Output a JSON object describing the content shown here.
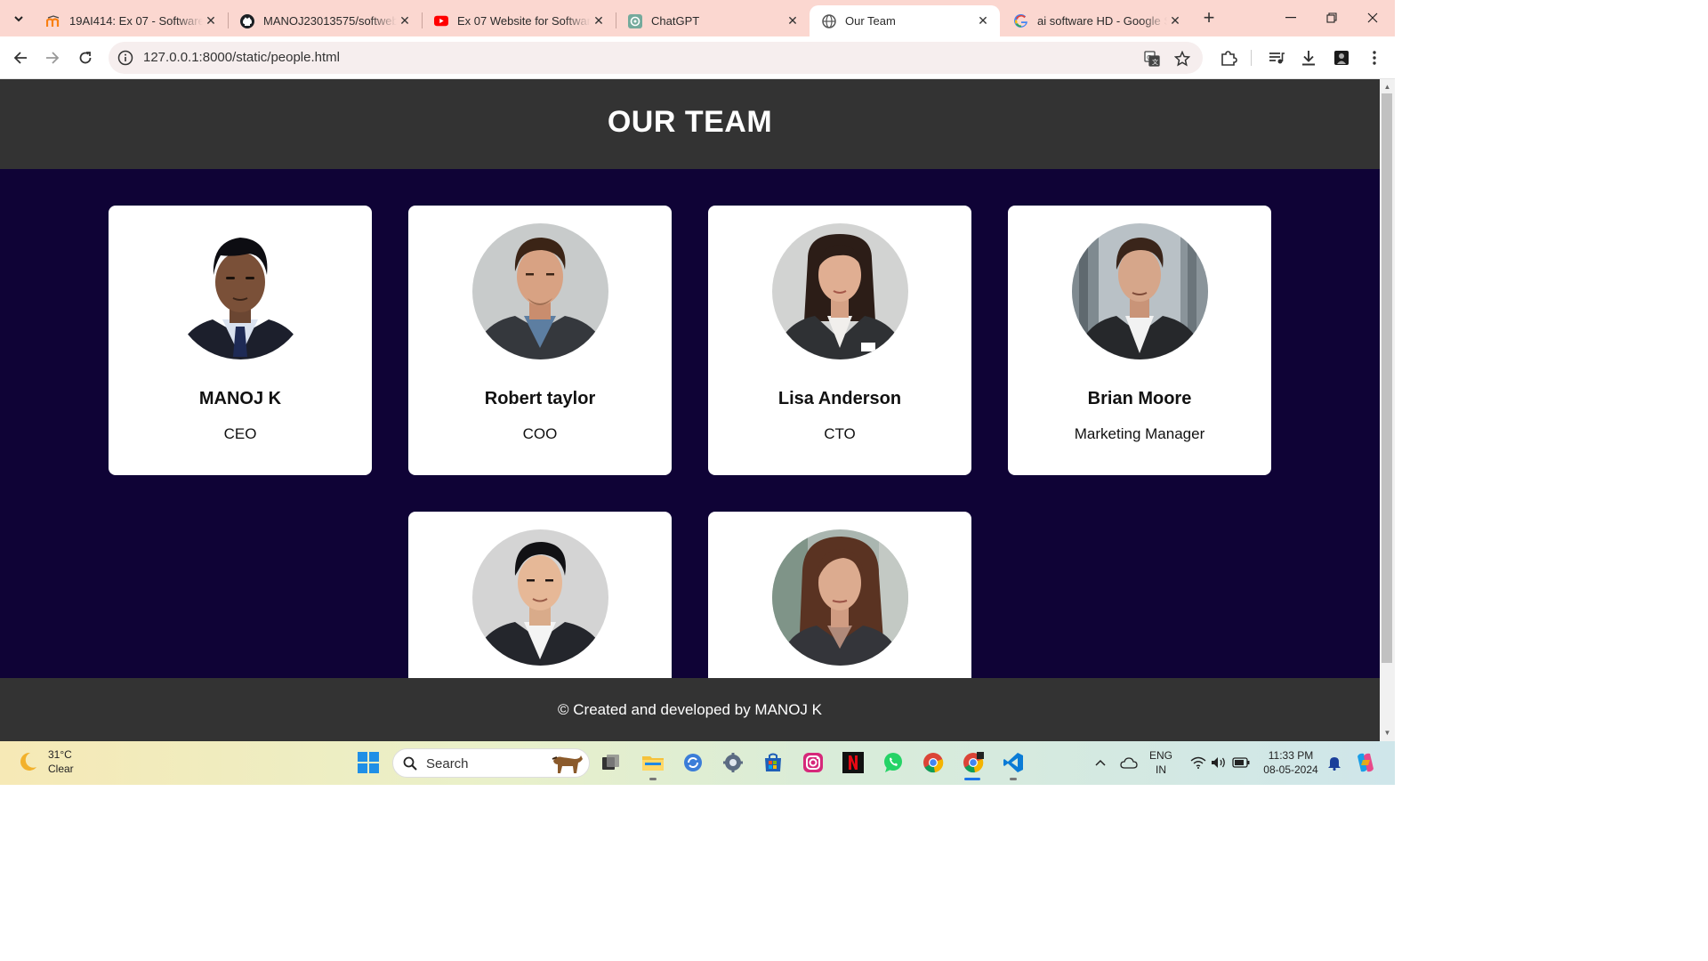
{
  "browser": {
    "tabs": [
      {
        "title": "19AI414: Ex 07 - Software D",
        "icon": "moodle-icon"
      },
      {
        "title": "MANOJ23013575/softweb",
        "icon": "github-icon"
      },
      {
        "title": "Ex 07 Website for Software",
        "icon": "youtube-icon"
      },
      {
        "title": "ChatGPT",
        "icon": "chatgpt-icon"
      },
      {
        "title": "Our Team",
        "icon": "globe-icon"
      },
      {
        "title": "ai software HD - Google Se",
        "icon": "google-icon"
      }
    ],
    "active_tab": 4,
    "url": "127.0.0.1:8000/static/people.html"
  },
  "page": {
    "title": "OUR TEAM",
    "members": [
      {
        "name": "MANOJ K",
        "role": "CEO"
      },
      {
        "name": "Robert taylor",
        "role": "COO"
      },
      {
        "name": "Lisa Anderson",
        "role": "CTO"
      },
      {
        "name": "Brian Moore",
        "role": "Marketing Manager"
      },
      {
        "name": "",
        "role": ""
      },
      {
        "name": "",
        "role": ""
      }
    ],
    "footer": "© Created and developed by MANOJ K"
  },
  "taskbar": {
    "weather": {
      "temp": "31°C",
      "condition": "Clear"
    },
    "search_label": "Search",
    "lang": {
      "line1": "ENG",
      "line2": "IN"
    },
    "clock": {
      "time": "11:33 PM",
      "date": "08-05-2024"
    }
  },
  "colors": {
    "page_bg": "#0f0336",
    "header_bg": "#333333",
    "tabbar_bg": "#fbd7d0",
    "card_bg": "#ffffff"
  }
}
